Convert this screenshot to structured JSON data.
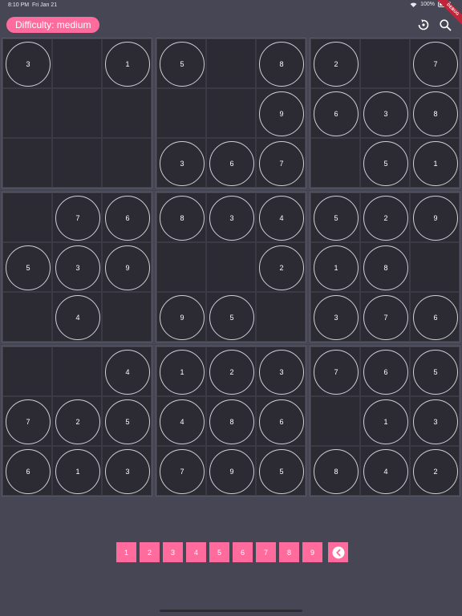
{
  "status_bar": {
    "time": "8:10 PM",
    "date": "Fri Jan 21",
    "battery": "100%"
  },
  "debug_banner": "DEBUG",
  "header": {
    "difficulty_label": "Difficulty: medium"
  },
  "board": {
    "boxes": [
      [
        "3",
        "",
        "1",
        "",
        "",
        "",
        "",
        "",
        ""
      ],
      [
        "5",
        "",
        "8",
        "",
        "",
        "9",
        "3",
        "6",
        "7"
      ],
      [
        "2",
        "",
        "7",
        "6",
        "3",
        "8",
        "",
        "5",
        "1"
      ],
      [
        "",
        "7",
        "6",
        "5",
        "3",
        "9",
        "",
        "4",
        ""
      ],
      [
        "8",
        "3",
        "4",
        "",
        "",
        "2",
        "9",
        "5",
        ""
      ],
      [
        "5",
        "2",
        "9",
        "1",
        "8",
        "",
        "3",
        "7",
        "6"
      ],
      [
        "",
        "",
        "4",
        "7",
        "2",
        "5",
        "6",
        "1",
        "3"
      ],
      [
        "1",
        "2",
        "3",
        "4",
        "8",
        "6",
        "7",
        "9",
        "5"
      ],
      [
        "7",
        "6",
        "5",
        "",
        "1",
        "3",
        "8",
        "4",
        "2"
      ]
    ]
  },
  "number_pad": {
    "numbers": [
      "1",
      "2",
      "3",
      "4",
      "5",
      "6",
      "7",
      "8",
      "9"
    ]
  },
  "colors": {
    "accent": "#ff6b9d",
    "background": "#474655",
    "board": "#2c2b33"
  },
  "icons": {
    "reset": "reset-icon",
    "search": "search-icon",
    "back": "back-icon"
  }
}
